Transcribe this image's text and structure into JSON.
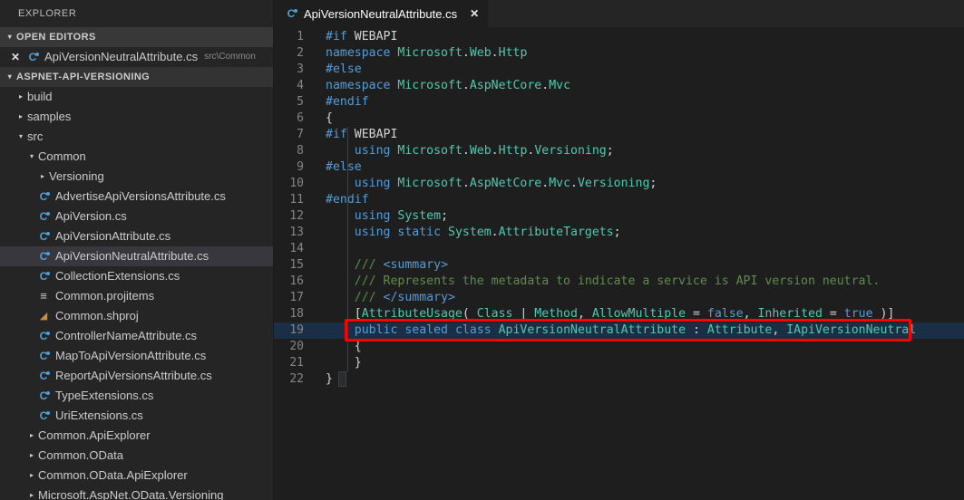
{
  "sidebar": {
    "title": "EXPLORER",
    "open_editors": {
      "label": "OPEN EDITORS",
      "items": [
        {
          "name": "ApiVersionNeutralAttribute.cs",
          "path": "src\\Common",
          "icon": "csharp-icon",
          "close": "✕"
        }
      ]
    },
    "project": {
      "label": "ASPNET-API-VERSIONING",
      "tree": [
        {
          "label": "build",
          "type": "folder",
          "state": "closed",
          "indent": 1
        },
        {
          "label": "samples",
          "type": "folder",
          "state": "closed",
          "indent": 1
        },
        {
          "label": "src",
          "type": "folder",
          "state": "open",
          "indent": 1
        },
        {
          "label": "Common",
          "type": "folder",
          "state": "open",
          "indent": 2
        },
        {
          "label": "Versioning",
          "type": "folder",
          "state": "closed",
          "indent": 3
        },
        {
          "label": "AdvertiseApiVersionsAttribute.cs",
          "type": "file",
          "icon": "csharp-icon",
          "indent": 3
        },
        {
          "label": "ApiVersion.cs",
          "type": "file",
          "icon": "csharp-icon",
          "indent": 3
        },
        {
          "label": "ApiVersionAttribute.cs",
          "type": "file",
          "icon": "csharp-icon",
          "indent": 3
        },
        {
          "label": "ApiVersionNeutralAttribute.cs",
          "type": "file",
          "icon": "csharp-icon",
          "indent": 3,
          "selected": true
        },
        {
          "label": "CollectionExtensions.cs",
          "type": "file",
          "icon": "csharp-icon",
          "indent": 3
        },
        {
          "label": "Common.projitems",
          "type": "file",
          "icon": "xml-icon",
          "indent": 3
        },
        {
          "label": "Common.shproj",
          "type": "file",
          "icon": "shproj-icon",
          "indent": 3
        },
        {
          "label": "ControllerNameAttribute.cs",
          "type": "file",
          "icon": "csharp-icon",
          "indent": 3
        },
        {
          "label": "MapToApiVersionAttribute.cs",
          "type": "file",
          "icon": "csharp-icon",
          "indent": 3
        },
        {
          "label": "ReportApiVersionsAttribute.cs",
          "type": "file",
          "icon": "csharp-icon",
          "indent": 3
        },
        {
          "label": "TypeExtensions.cs",
          "type": "file",
          "icon": "csharp-icon",
          "indent": 3
        },
        {
          "label": "UriExtensions.cs",
          "type": "file",
          "icon": "csharp-icon",
          "indent": 3
        },
        {
          "label": "Common.ApiExplorer",
          "type": "folder",
          "state": "closed",
          "indent": 2
        },
        {
          "label": "Common.OData",
          "type": "folder",
          "state": "closed",
          "indent": 2
        },
        {
          "label": "Common.OData.ApiExplorer",
          "type": "folder",
          "state": "closed",
          "indent": 2
        },
        {
          "label": "Microsoft.AspNet.OData.Versioning",
          "type": "folder",
          "state": "closed",
          "indent": 2
        }
      ]
    }
  },
  "editor": {
    "tab": {
      "label": "ApiVersionNeutralAttribute.cs",
      "icon": "csharp-icon",
      "close": "✕"
    },
    "lines": [
      {
        "n": "1",
        "text": "#if WEBAPI"
      },
      {
        "n": "2",
        "text": "namespace Microsoft.Web.Http"
      },
      {
        "n": "3",
        "text": "#else"
      },
      {
        "n": "4",
        "text": "namespace Microsoft.AspNetCore.Mvc"
      },
      {
        "n": "5",
        "text": "#endif"
      },
      {
        "n": "6",
        "text": "{"
      },
      {
        "n": "7",
        "text": "#if WEBAPI"
      },
      {
        "n": "8",
        "text": "    using Microsoft.Web.Http.Versioning;"
      },
      {
        "n": "9",
        "text": "#else"
      },
      {
        "n": "10",
        "text": "    using Microsoft.AspNetCore.Mvc.Versioning;"
      },
      {
        "n": "11",
        "text": "#endif"
      },
      {
        "n": "12",
        "text": "    using System;"
      },
      {
        "n": "13",
        "text": "    using static System.AttributeTargets;"
      },
      {
        "n": "14",
        "text": ""
      },
      {
        "n": "15",
        "text": "    /// <summary>"
      },
      {
        "n": "16",
        "text": "    /// Represents the metadata to indicate a service is API version neutral."
      },
      {
        "n": "17",
        "text": "    /// </summary>"
      },
      {
        "n": "18",
        "text": "    [AttributeUsage( Class | Method, AllowMultiple = false, Inherited = true )]"
      },
      {
        "n": "19",
        "text": "    public sealed class ApiVersionNeutralAttribute : Attribute, IApiVersionNeutral",
        "highlighted": true
      },
      {
        "n": "20",
        "text": "    {"
      },
      {
        "n": "21",
        "text": "    }"
      },
      {
        "n": "22",
        "text": "}"
      }
    ],
    "annotation": {
      "type": "red-rectangle",
      "color": "#fe0000",
      "targets_line": "19"
    }
  },
  "colors": {
    "sidebar_bg": "#252526",
    "editor_bg": "#1e1e1e",
    "keyword": "#569cd6",
    "type": "#4ec9b0",
    "comment": "#57a64a",
    "preprocessor": "#9b9b9b",
    "plain": "#d4d4d4",
    "line_number": "#858585",
    "selection": "#37373d",
    "annotation_red": "#fe0000"
  }
}
